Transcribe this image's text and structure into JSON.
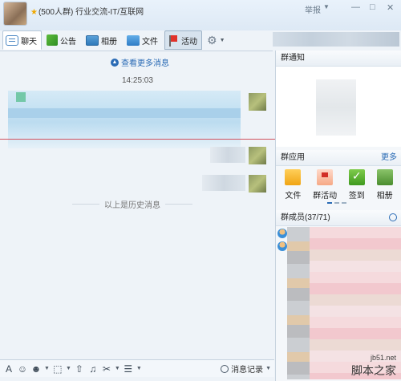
{
  "window": {
    "title": "(500人群) 行业交流-IT/互联网",
    "report": "举报",
    "controls": [
      "—",
      "□",
      "✕"
    ]
  },
  "tabs": [
    {
      "label": "聊天",
      "icon": "chat-icon",
      "active": true
    },
    {
      "label": "公告",
      "icon": "notice-icon"
    },
    {
      "label": "相册",
      "icon": "album-icon"
    },
    {
      "label": "文件",
      "icon": "file-icon"
    },
    {
      "label": "活动",
      "icon": "flag-icon"
    }
  ],
  "chat": {
    "more_messages": "查看更多消息",
    "timestamp": "14:25:03",
    "history_label": "以上是历史消息"
  },
  "toolbar": {
    "history_button": "消息记录"
  },
  "right_panel": {
    "notice_title": "群通知",
    "apps_title": "群应用",
    "apps_more": "更多",
    "apps": [
      {
        "label": "文件",
        "icon": "folder-icon"
      },
      {
        "label": "群活动",
        "icon": "group-activity-icon"
      },
      {
        "label": "签到",
        "icon": "checkin-icon"
      },
      {
        "label": "相册",
        "icon": "photo-icon"
      }
    ],
    "members_title": "群成员(37/71)"
  },
  "watermark": {
    "site": "jb51.net",
    "name": "脚本之家"
  },
  "colors": {
    "accent": "#2a6bb5",
    "divider": "#d1515d"
  }
}
